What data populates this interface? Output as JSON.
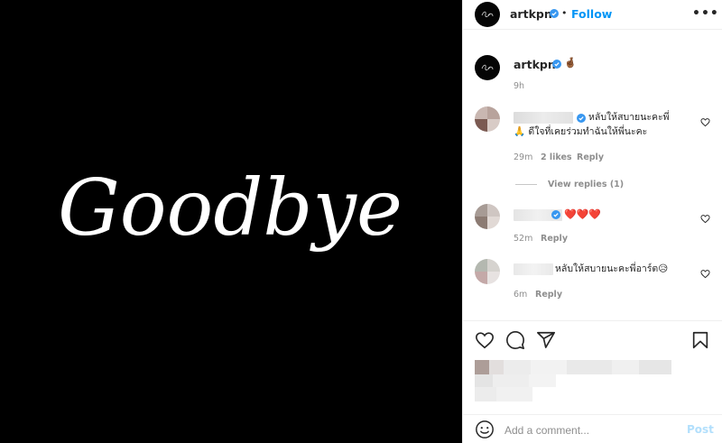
{
  "image": {
    "text": "Goodbye",
    "background": "#000000",
    "text_color": "#ffffff"
  },
  "header": {
    "username": "artkpn",
    "separator": "•",
    "follow_label": "Follow",
    "more_label": "•••"
  },
  "caption": {
    "username": "artkpn",
    "text": "🤞🏾",
    "time": "9h"
  },
  "comments": [
    {
      "text_line1": "หลับให้สบายนะคะพี่",
      "text_line2": "🙏 ดีใจที่เคยร่วมทำฉันให้พี่นะคะ",
      "time": "29m",
      "likes": "2 likes",
      "reply": "Reply",
      "view_replies": "View replies (1)"
    },
    {
      "text_line1": "❤️❤️❤️",
      "time": "52m",
      "reply": "Reply"
    },
    {
      "text_line1": "หลับให้สบายนะคะพี่อาร์ต😥",
      "time": "6m",
      "reply": "Reply"
    }
  ],
  "add_comment": {
    "placeholder": "Add a comment...",
    "post_label": "Post"
  },
  "colors": {
    "accent": "#0095f6",
    "muted": "#8e8e8e",
    "post_disabled": "#b2dffc",
    "heart_red": "#d61f26"
  },
  "icons": [
    "heart-icon",
    "comment-icon",
    "share-icon",
    "bookmark-icon",
    "emoji-icon",
    "verified-icon",
    "more-icon"
  ]
}
